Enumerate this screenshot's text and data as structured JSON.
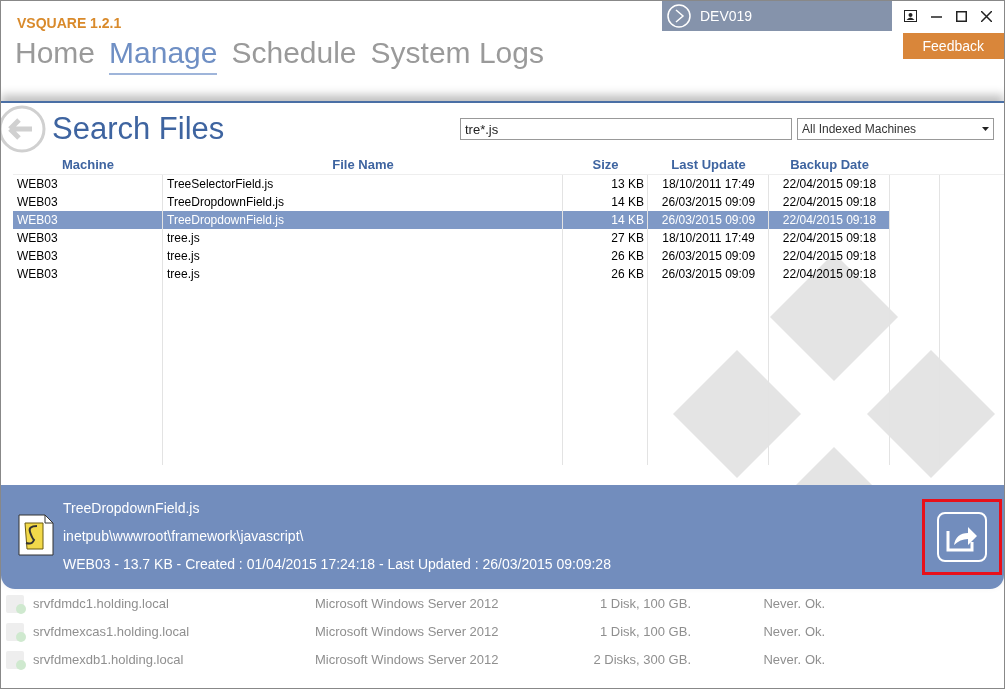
{
  "app": {
    "title": "VSQUARE 1.2.1",
    "machine": "DEV019",
    "feedback": "Feedback",
    "nav": [
      {
        "label": "Home",
        "selected": false
      },
      {
        "label": "Manage",
        "selected": true
      },
      {
        "label": "Schedule",
        "selected": false
      },
      {
        "label": "System Logs",
        "selected": false
      }
    ]
  },
  "dialog": {
    "title": "Search Files",
    "search": {
      "value": "tre*.js"
    },
    "scope": {
      "value": "All Indexed Machines"
    },
    "columns": [
      "Machine",
      "File Name",
      "Size",
      "Last Update",
      "Backup Date"
    ],
    "rows": [
      {
        "machine": "WEB03",
        "file": "TreeSelectorField.js",
        "size": "13 KB",
        "updated": "18/10/2011 17:49",
        "backup": "22/04/2015 09:18",
        "selected": false
      },
      {
        "machine": "WEB03",
        "file": "TreeDropdownField.js",
        "size": "14 KB",
        "updated": "26/03/2015 09:09",
        "backup": "22/04/2015 09:18",
        "selected": false
      },
      {
        "machine": "WEB03",
        "file": "TreeDropdownField.js",
        "size": "14 KB",
        "updated": "26/03/2015 09:09",
        "backup": "22/04/2015 09:18",
        "selected": true
      },
      {
        "machine": "WEB03",
        "file": "tree.js",
        "size": "27 KB",
        "updated": "18/10/2011 17:49",
        "backup": "22/04/2015 09:18",
        "selected": false
      },
      {
        "machine": "WEB03",
        "file": "tree.js",
        "size": "26 KB",
        "updated": "26/03/2015 09:09",
        "backup": "22/04/2015 09:18",
        "selected": false
      },
      {
        "machine": "WEB03",
        "file": "tree.js",
        "size": "26 KB",
        "updated": "26/03/2015 09:09",
        "backup": "22/04/2015 09:18",
        "selected": false
      }
    ],
    "details": {
      "name": "TreeDropdownField.js",
      "path": "inetpub\\wwwroot\\framework\\javascript\\",
      "info": "WEB03 - 13.7 KB - Created : 01/04/2015 17:24:18 - Last Updated : 26/03/2015 09:09:28",
      "share_highlighted": true
    }
  },
  "servers": [
    {
      "name": "srvfdmdc1.holding.local",
      "os": "Microsoft Windows Server 2012",
      "disks": "1 Disk, 100 GB.",
      "backup": "Never.",
      "status": "Ok."
    },
    {
      "name": "srvfdmexcas1.holding.local",
      "os": "Microsoft Windows Server 2012",
      "disks": "1 Disk, 100 GB.",
      "backup": "Never.",
      "status": "Ok."
    },
    {
      "name": "srvfdmexdb1.holding.local",
      "os": "Microsoft Windows Server 2012",
      "disks": "2 Disks, 300 GB.",
      "backup": "Never.",
      "status": "Ok."
    }
  ]
}
